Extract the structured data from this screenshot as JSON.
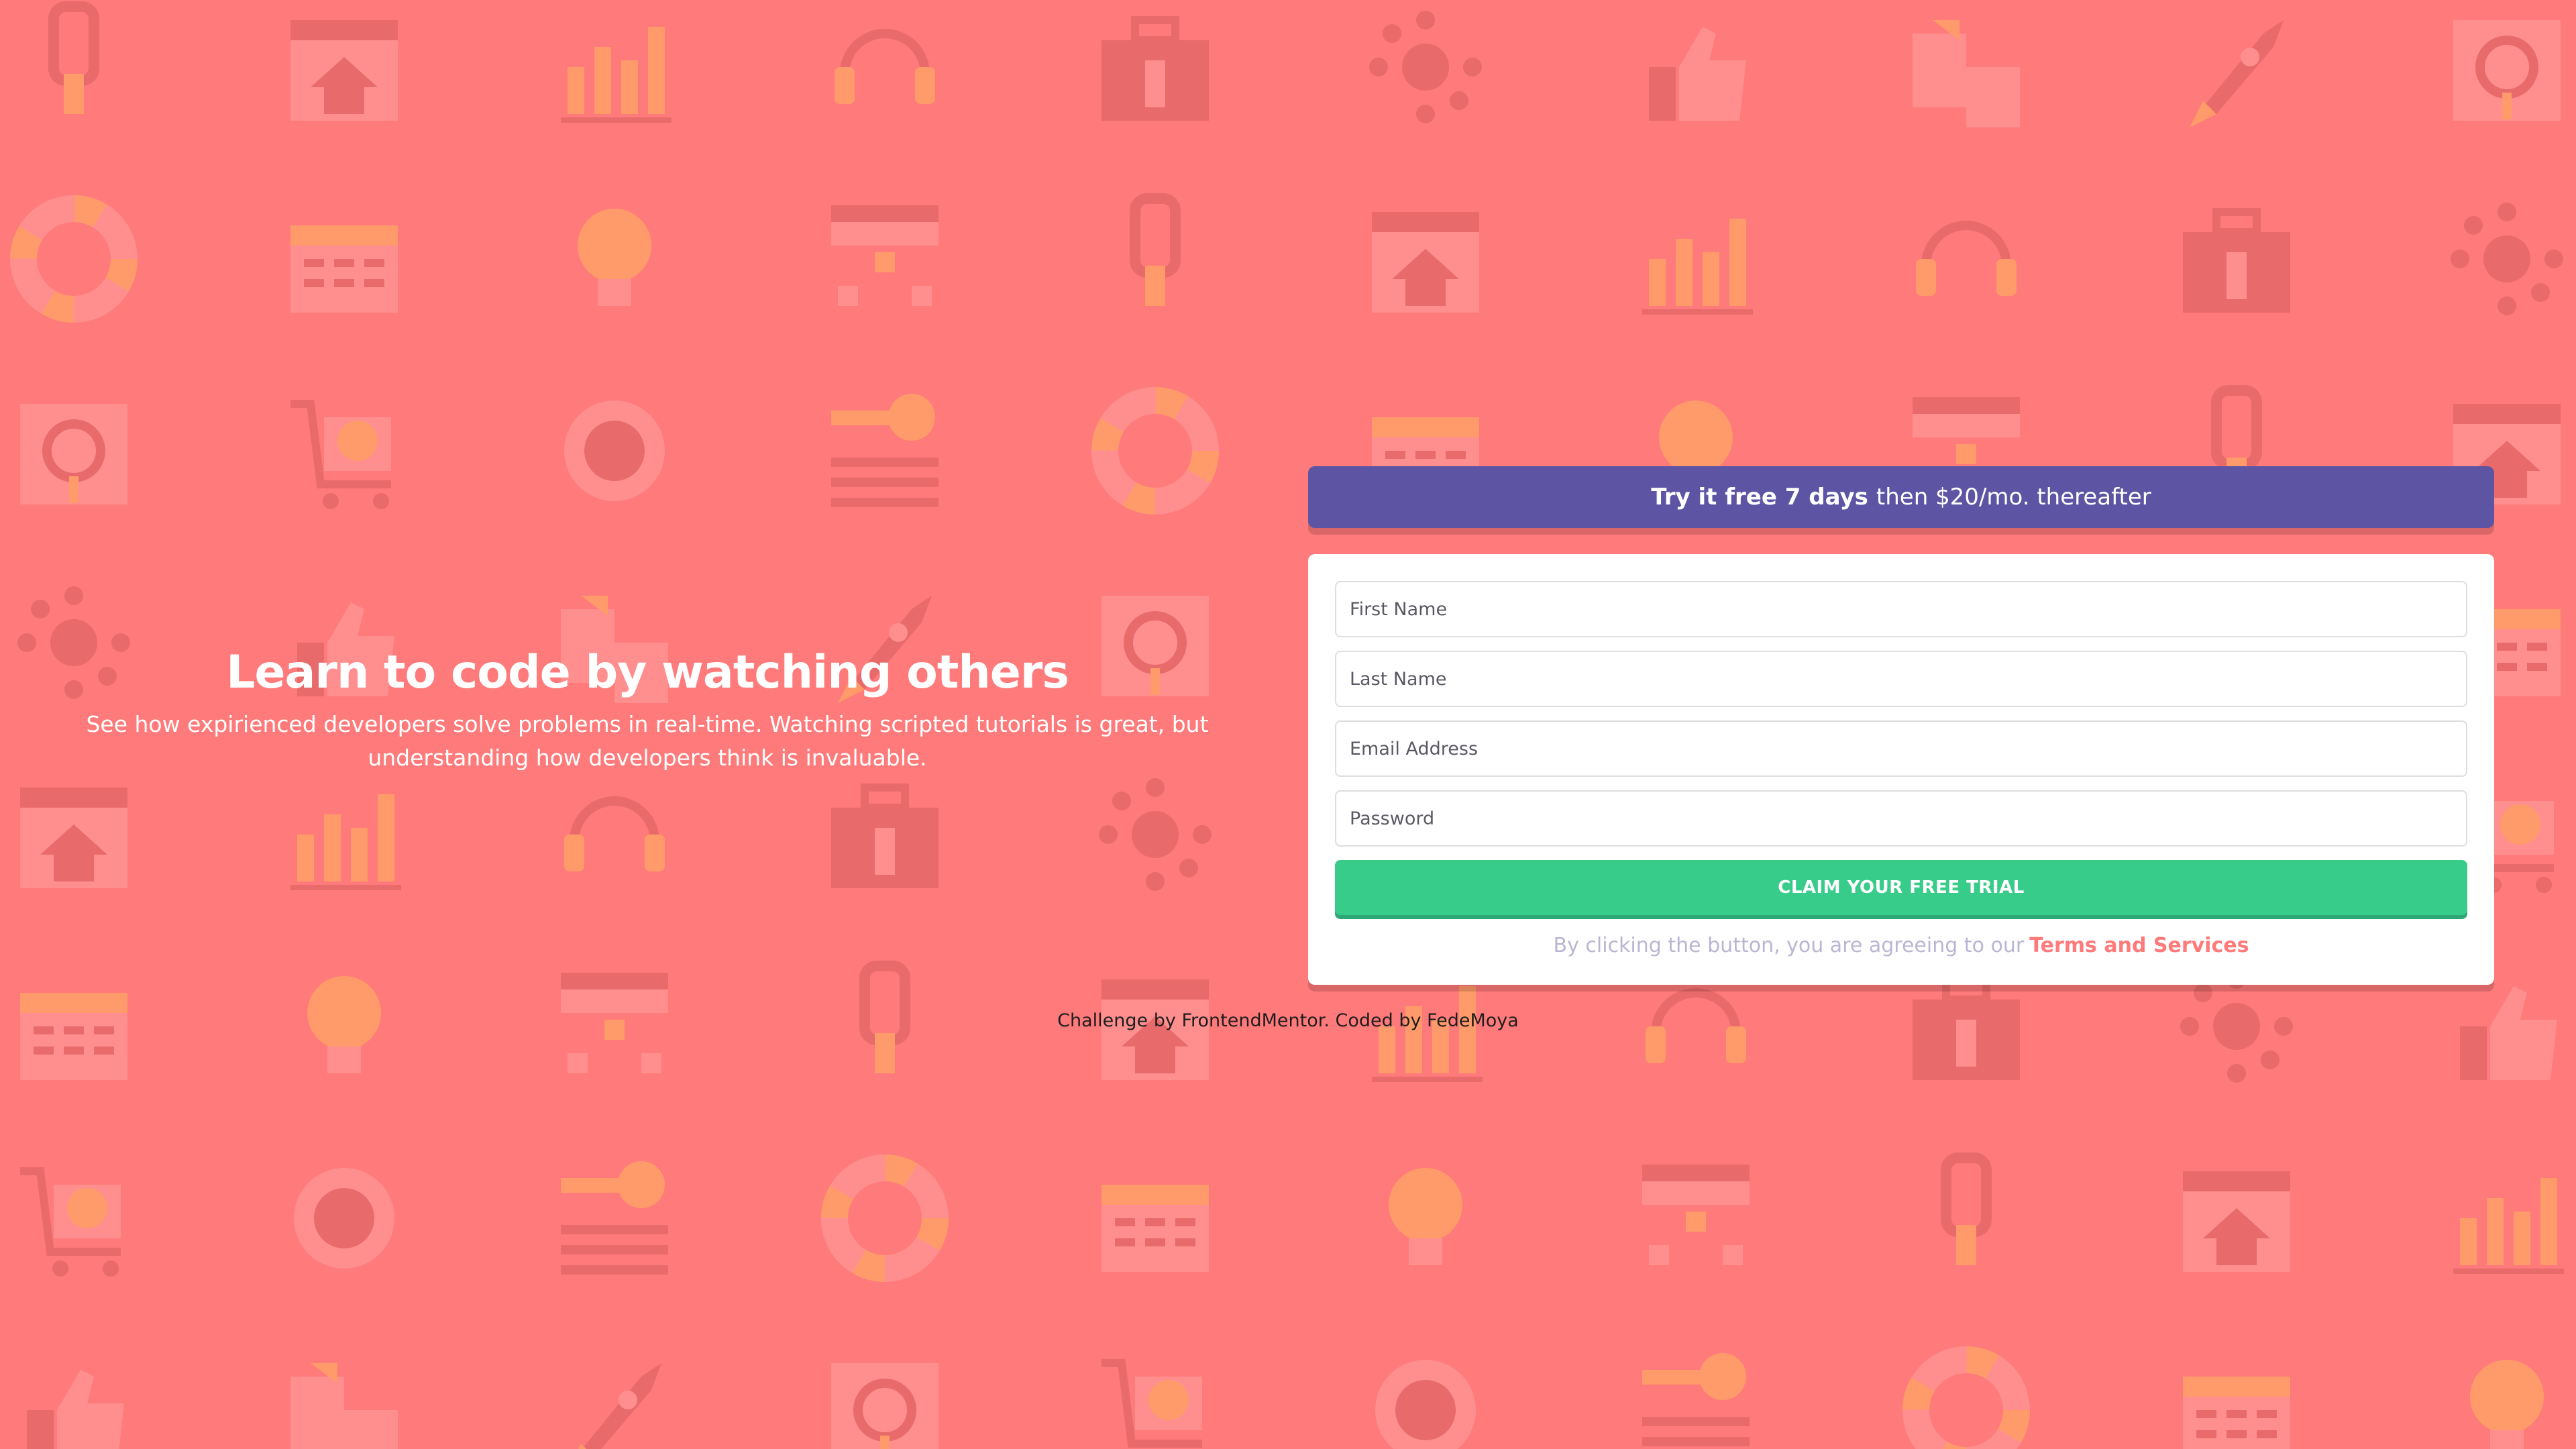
{
  "colors": {
    "background": "#ff7a7a",
    "banner": "#5e54a4",
    "button": "#38cc8b",
    "terms_link": "#ff7a7a",
    "terms_text": "#b9b6d3"
  },
  "hero": {
    "title": "Learn to code by watching others",
    "description": "See how expirienced developers solve problems in real-time. Watching scripted tutorials is great, but understanding how developers think is invaluable."
  },
  "banner": {
    "bold": "Try it free 7 days",
    "rest": "then $20/mo. thereafter"
  },
  "form": {
    "first_name_placeholder": "First Name",
    "last_name_placeholder": "Last Name",
    "email_placeholder": "Email Address",
    "password_placeholder": "Password",
    "submit_label": "CLAIM YOUR FREE TRIAL",
    "terms_text": "By clicking the button, you are agreeing to our",
    "terms_link": "Terms and Services"
  },
  "footer": {
    "text": "Challenge by FrontendMentor. Coded by FedeMoya"
  },
  "background_icons": [
    "plug-icon",
    "browser-home-icon",
    "bar-chart-icon",
    "headset-icon",
    "toolbox-icon",
    "network-icon",
    "thumbs-up-icon",
    "documents-icon",
    "rocket-icon",
    "magnifier-icon",
    "cart-icon",
    "globe-gear-icon",
    "key-icon",
    "lifebuoy-icon",
    "calendar-icon",
    "lightbulb-icon",
    "sitemap-icon"
  ]
}
